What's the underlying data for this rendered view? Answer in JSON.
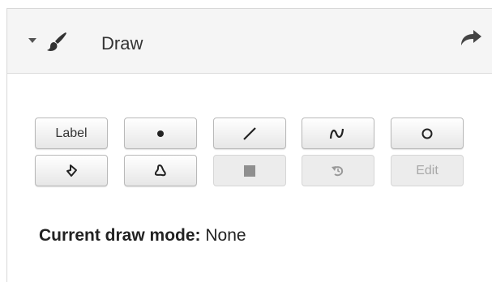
{
  "header": {
    "title": "Draw",
    "caret_icon": "caret-down-icon",
    "tool_icon": "paint-brush-icon",
    "action_icon": "share-arrow-icon"
  },
  "tools": [
    {
      "name": "label",
      "label": "Label",
      "icon": null,
      "disabled": false
    },
    {
      "name": "point",
      "label": "",
      "icon": "point-icon",
      "disabled": false
    },
    {
      "name": "line",
      "label": "",
      "icon": "line-icon",
      "disabled": false
    },
    {
      "name": "curve",
      "label": "",
      "icon": "curve-icon",
      "disabled": false
    },
    {
      "name": "circle",
      "label": "",
      "icon": "circle-icon",
      "disabled": false
    },
    {
      "name": "polygon",
      "label": "",
      "icon": "polygon-icon",
      "disabled": false
    },
    {
      "name": "freeform",
      "label": "",
      "icon": "freeform-shape-icon",
      "disabled": false
    },
    {
      "name": "stop",
      "label": "",
      "icon": "stop-square-icon",
      "disabled": true
    },
    {
      "name": "undo",
      "label": "",
      "icon": "undo-icon",
      "disabled": true
    },
    {
      "name": "edit",
      "label": "Edit",
      "icon": null,
      "disabled": true
    }
  ],
  "status": {
    "prefix": "Current draw mode:",
    "value": "None"
  },
  "colors": {
    "header_bg": "#f5f5f5",
    "button_border": "#b9b9b9",
    "disabled_text": "#a8a8a8"
  }
}
